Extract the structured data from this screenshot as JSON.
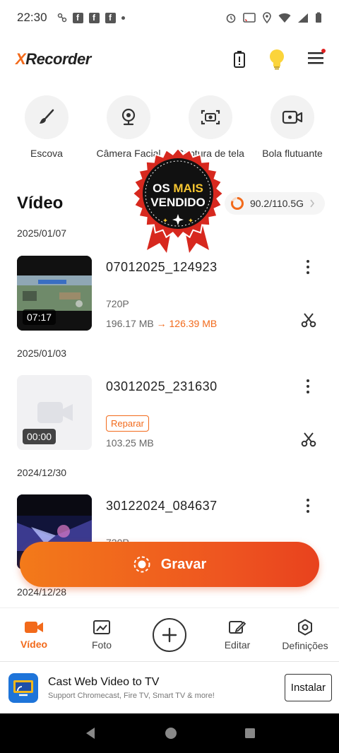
{
  "status_bar": {
    "time": "22:30"
  },
  "app": {
    "logo_x": "X",
    "logo_rest": "Recorder"
  },
  "tools": [
    {
      "label": "Escova",
      "icon": "brush-icon"
    },
    {
      "label": "Câmera Facial",
      "icon": "webcam-icon"
    },
    {
      "label": "Captura de tela",
      "icon": "screenshot-icon"
    },
    {
      "label": "Bola flutuante",
      "icon": "floating-camera-icon"
    }
  ],
  "section": {
    "title": "Vídeo",
    "storage": "90.2/110.5G",
    "storage_used_fraction": 0.816
  },
  "badge": {
    "line1_a": "OS ",
    "line1_b": "MAIS",
    "line2": "VENDIDO"
  },
  "videos": [
    {
      "date": "2025/01/07",
      "name": "07012025_124923",
      "duration": "07:17",
      "resolution": "720P",
      "size": "196.17 MB",
      "arrow": "→",
      "new_size": "126.39 MB"
    },
    {
      "date": "2025/01/03",
      "name": "03012025_231630",
      "duration": "00:00",
      "repair": "Reparar",
      "size": "103.25 MB"
    },
    {
      "date": "2024/12/30",
      "name": "30122024_084637",
      "resolution": "720P"
    },
    {
      "date": "2024/12/28"
    }
  ],
  "record_button": {
    "label": "Gravar"
  },
  "nav": [
    {
      "label": "Vídeo",
      "icon": "video-camera-icon",
      "active": true
    },
    {
      "label": "Foto",
      "icon": "photo-icon"
    },
    {
      "label": "",
      "icon": "plus-icon"
    },
    {
      "label": "Editar",
      "icon": "edit-icon"
    },
    {
      "label": "Definições",
      "icon": "settings-icon"
    }
  ],
  "ad": {
    "title": "Cast Web Video to TV",
    "subtitle": "Support Chromecast, Fire TV, Smart TV & more!",
    "button": "Instalar"
  },
  "colors": {
    "accent": "#f26a1b",
    "record_gradient_end": "#e8421e",
    "badge_red": "#d7281e"
  }
}
